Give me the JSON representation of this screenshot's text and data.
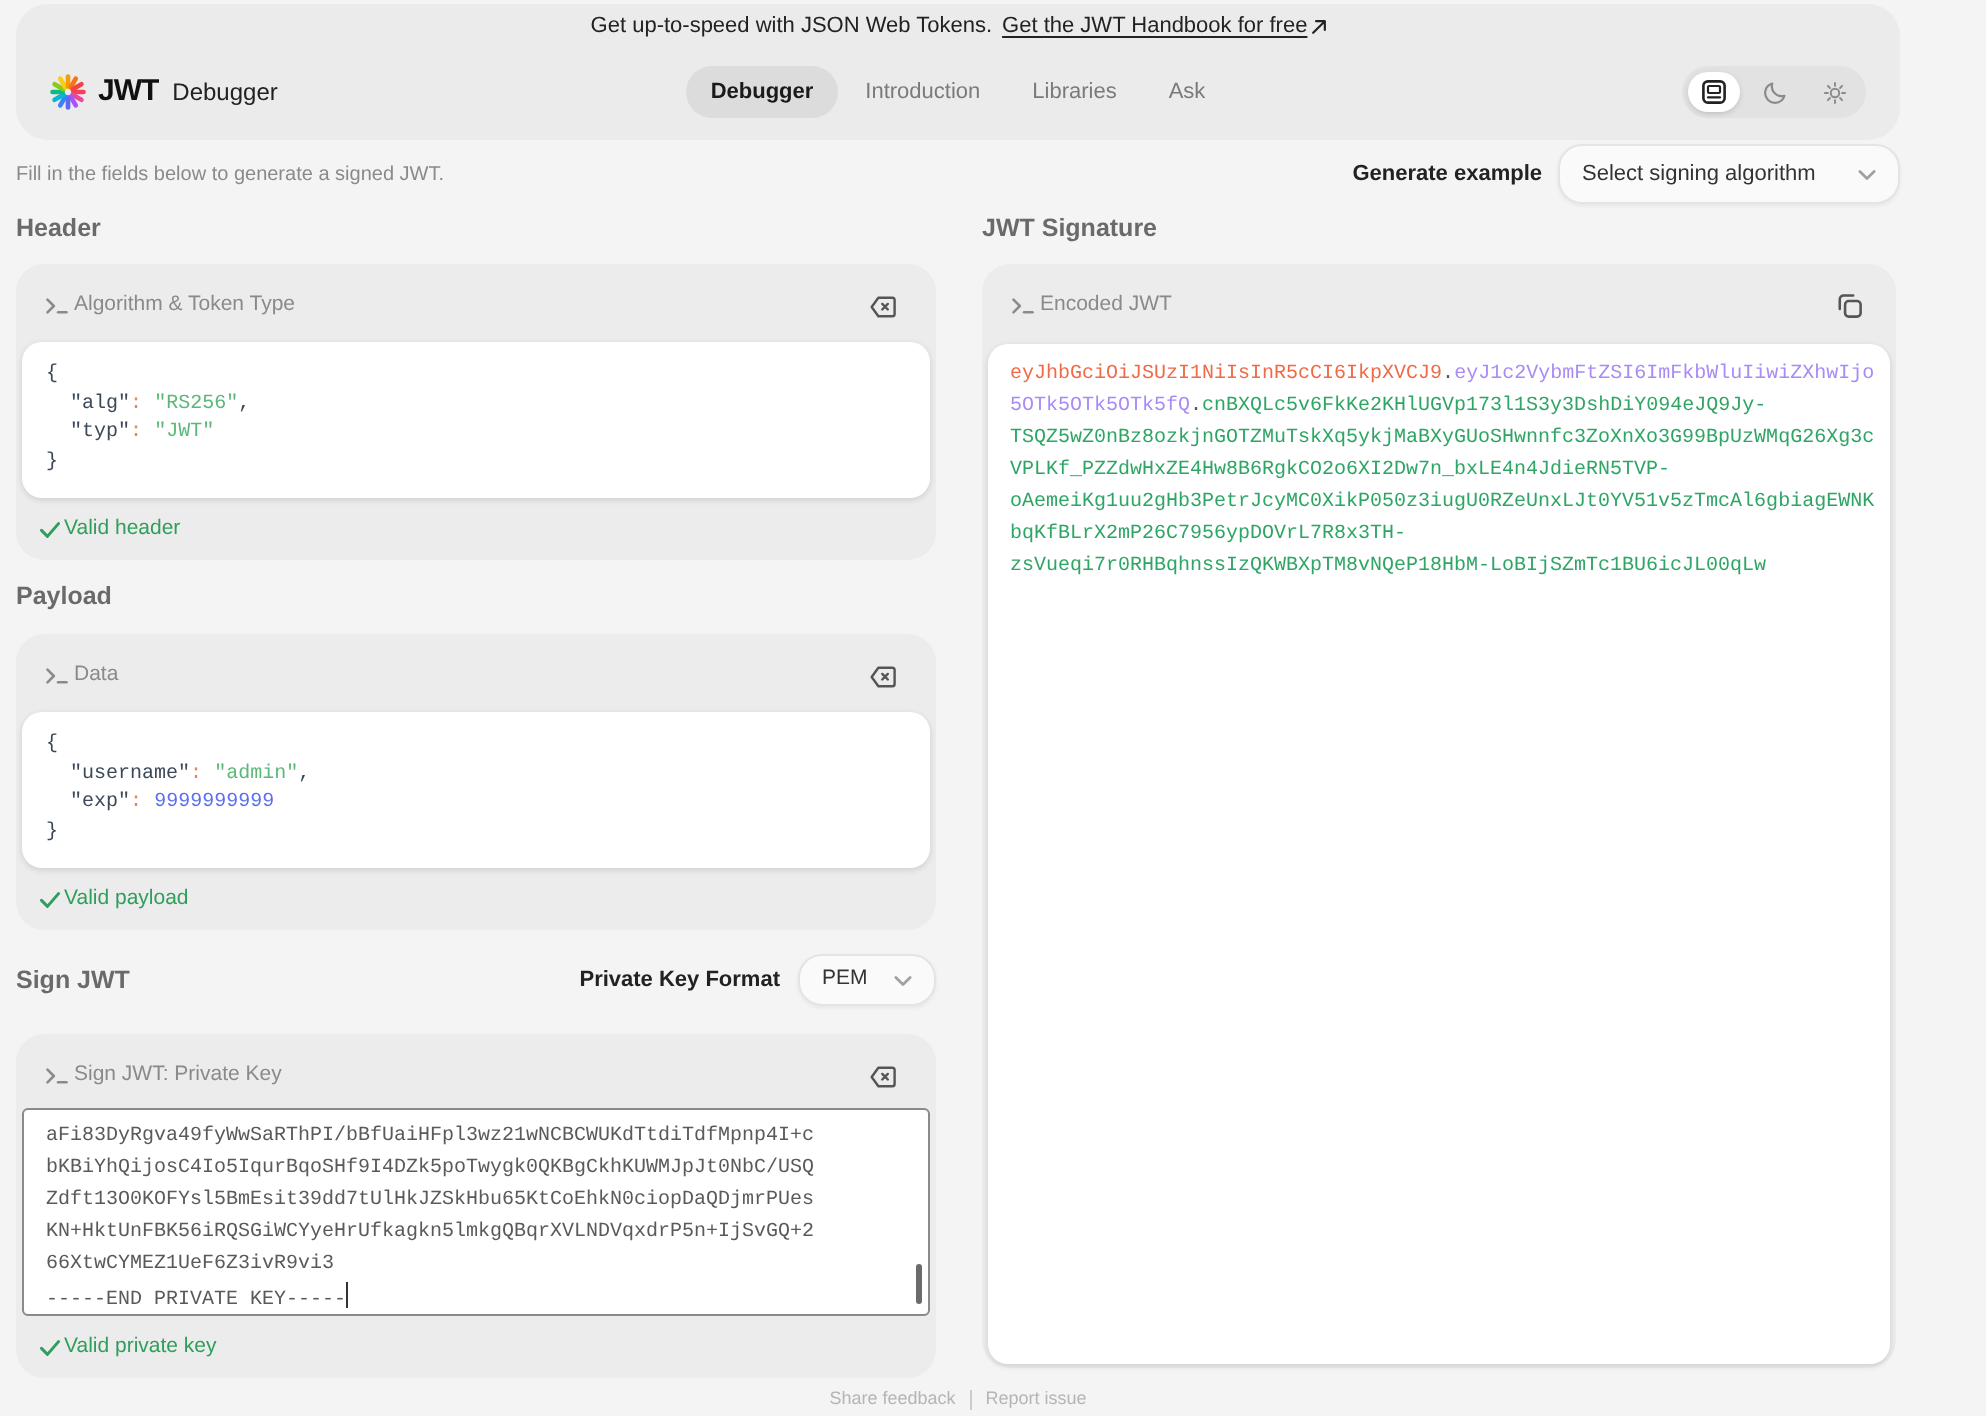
{
  "banner": {
    "text": "Get up-to-speed with JSON Web Tokens.",
    "link": "Get the JWT Handbook for free"
  },
  "brand": {
    "wordmark": "JWT",
    "title": "Debugger"
  },
  "nav": [
    {
      "label": "Debugger",
      "selected": true
    },
    {
      "label": "Introduction",
      "selected": false
    },
    {
      "label": "Libraries",
      "selected": false
    },
    {
      "label": "Ask",
      "selected": false
    }
  ],
  "theme_switcher": [
    {
      "kind": "system",
      "selected": true
    },
    {
      "kind": "dark",
      "selected": false
    },
    {
      "kind": "light",
      "selected": false
    }
  ],
  "intro": "Fill in the fields below to generate a signed JWT.",
  "generate_example": {
    "label": "Generate example",
    "select": "Select signing algorithm"
  },
  "header": {
    "title": "Header",
    "panel_title": "Algorithm & Token Type",
    "code": "{\n  \"alg\": \"RS256\",\n  \"typ\": \"JWT\"\n}",
    "valid": true,
    "status": "Valid header"
  },
  "payload": {
    "title": "Payload",
    "panel_title": "Data",
    "code": "{\n  \"username\": \"admin\",\n  \"exp\": 9999999999\n}",
    "valid": true,
    "status": "Valid payload"
  },
  "sign": {
    "title": "Sign JWT",
    "format_label": "Private Key Format",
    "format": "PEM",
    "panel_title": "Sign JWT: Private Key",
    "key_lines": [
      "aFi83DyRgva49fyWwSaRThPI/bBfUaiHFpl3wz21wNCBCWUKdTtdiTdfMpnp4I+c",
      "bKBiYhQijosC4Io5IqurBqoSHf9I4DZk5poTwygk0QKBgCkhKUWMJpJt0NbC/USQ",
      "Zdft13O0KOFYsl5BmEsit39dd7tUlHkJZSkHbu65KtCoEhkN0ciopDaQDjmrPUes",
      "KN+HktUnFBK56iRQSGiWCYyeHrUfkagkn5lmkgQBqrXVLNDVqxdrP5n+IjSvGQ+2",
      "66XtwCYMEZ1UeF6Z3ivR9vi3",
      "-----END PRIVATE KEY-----"
    ],
    "focused": true,
    "valid": true,
    "status": "Valid private key"
  },
  "signature": {
    "title": "JWT Signature",
    "panel_title": "Encoded JWT",
    "segments": [
      {
        "kind": "header",
        "text": "eyJhbGciOiJSUzI1NiIsInR5cCI6IkpXVCJ9"
      },
      {
        "kind": "separator",
        "text": "."
      },
      {
        "kind": "payload",
        "text": "eyJ1c2VybmFtZSI6ImFkbWluIiwiZXhwIjo5OTk5OTk5OTk5fQ"
      },
      {
        "kind": "separator",
        "text": "."
      },
      {
        "kind": "signature",
        "text": "cnBXQLc5v6FkKe2KHlUGVp173l1S3y3DshDiY094eJQ9Jy-TSQZ5wZ0nBz8ozkjnGOTZMuTskXq5ykjMaBXyGUoSHwnnfc3ZoXnXo3G99BpUzWMqG26Xg3cVPLKf_PZZdwHxZE4Hw8B6RgkCO2o6XI2Dw7n_bxLE4n4JdieRN5TVP-oAemeiKg1uu2gHb3PetrJcyMC0XikP050z3iugU0RZeUnxLJt0YV51v5zTmcAl6gbiagEWNKbqKfBLrX2mP26C7956ypDOVrL7R8x3TH-zsVueqi7r0RHBqhnssIzQKWBXpTM8vNQeP18HbM-LoBIjSZmTc1BU6icJL00qLw"
      }
    ]
  },
  "footer": [
    "Share feedback",
    "Report issue"
  ]
}
